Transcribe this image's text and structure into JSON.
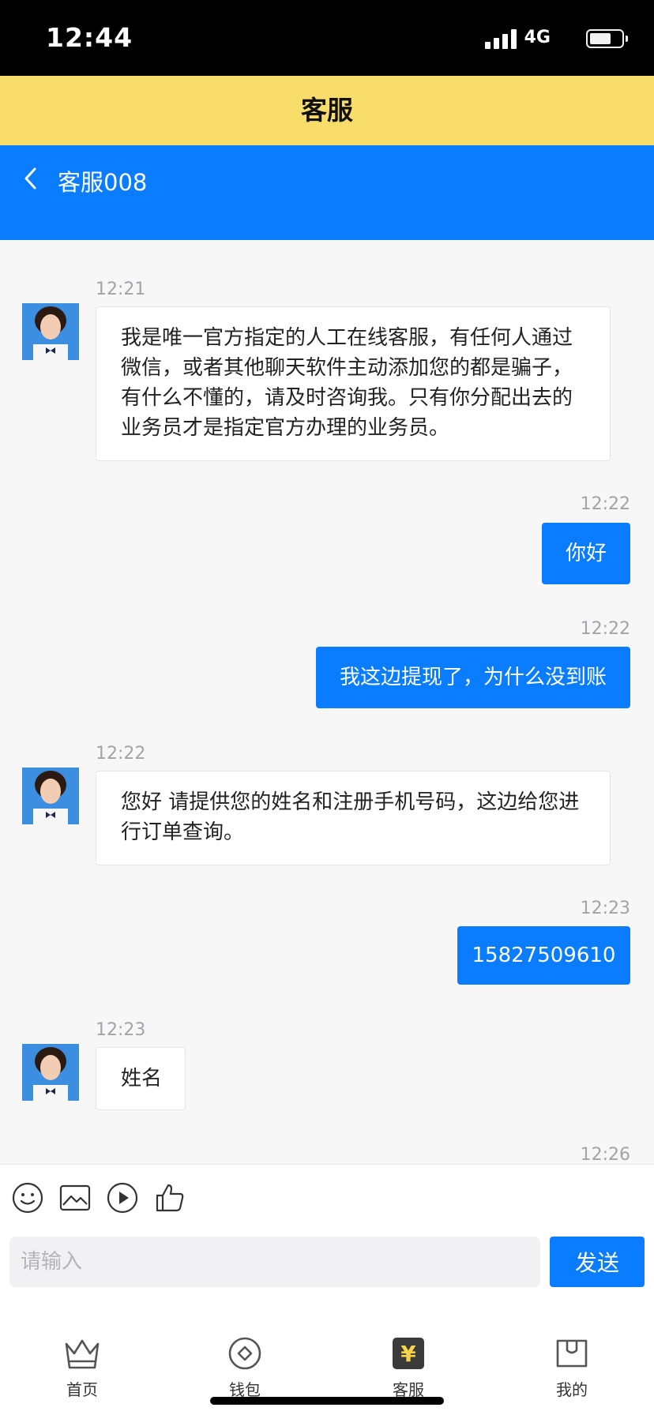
{
  "status_bar": {
    "time": "12:44",
    "network": "4G"
  },
  "page_title": "客服",
  "chat_header": {
    "agent_name": "客服008"
  },
  "messages": [
    {
      "side": "in",
      "time": "12:21",
      "lines": [
        "我是唯一官方指定的人工在线客服，有任何人通过",
        "微信，或者其他聊天软件主动添加您的都是骗子，",
        "有什么不懂的，请及时咨询我。只有你分配出去的",
        "业务员才是指定官方办理的业务员。"
      ]
    },
    {
      "side": "out",
      "time": "12:22",
      "text": "你好"
    },
    {
      "side": "out",
      "time": "12:22",
      "text": "我这边提现了，为什么没到账"
    },
    {
      "side": "in",
      "time": "12:22",
      "lines": [
        "您好 请提供您的姓名和注册手机号码，这边给您进",
        "行订单查询。"
      ]
    },
    {
      "side": "out",
      "time": "12:23",
      "text": "15827509610"
    },
    {
      "side": "in",
      "time": "12:23",
      "lines": [
        "姓名"
      ]
    },
    {
      "side": "out",
      "time": "12:26"
    }
  ],
  "toolbar": {
    "icons": [
      "emoji-icon",
      "image-icon",
      "video-icon",
      "thumbs-up-icon"
    ]
  },
  "composer": {
    "placeholder": "请输入",
    "send_label": "发送"
  },
  "tabbar": {
    "items": [
      {
        "label": "首页",
        "icon": "crown-icon"
      },
      {
        "label": "钱包",
        "icon": "wallet-coin-icon"
      },
      {
        "label": "客服",
        "icon": "yen-icon",
        "active": true
      },
      {
        "label": "我的",
        "icon": "profile-card-icon"
      }
    ]
  },
  "colors": {
    "title_bar": "#f8dd6a",
    "accent_blue": "#0a7cff",
    "active_tab_icon": "#3a3a3a",
    "active_tab_glyph": "#f8d34a"
  }
}
